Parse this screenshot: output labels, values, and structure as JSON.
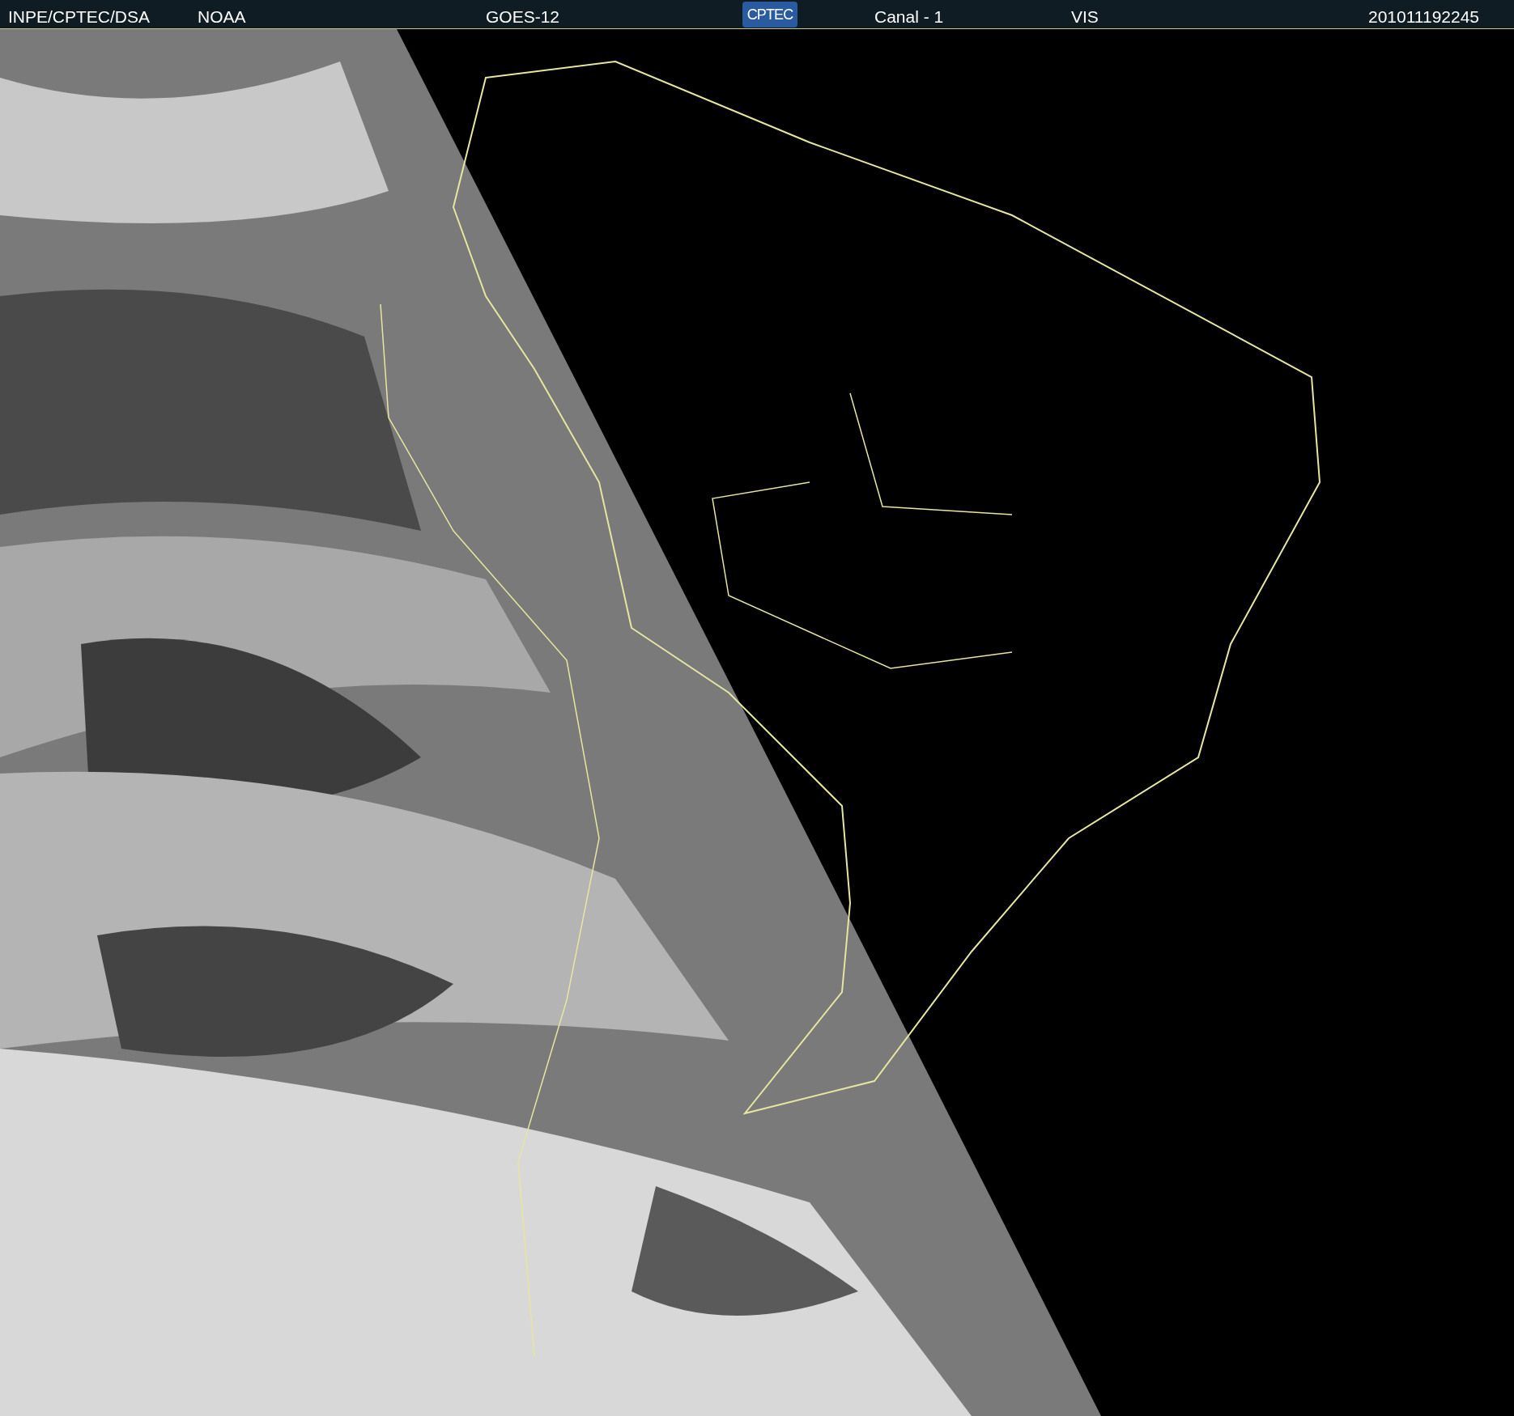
{
  "header": {
    "items": [
      {
        "kind": "text",
        "text": "INPE/CPTEC/DSA"
      },
      {
        "kind": "text",
        "text": "NOAA"
      },
      {
        "kind": "text",
        "text": "GOES-12"
      },
      {
        "kind": "logo",
        "text": "CPTEC"
      },
      {
        "kind": "text",
        "text": "Canal - 1"
      },
      {
        "kind": "text",
        "text": "VIS"
      },
      {
        "kind": "text",
        "text": "201011192245"
      }
    ]
  }
}
